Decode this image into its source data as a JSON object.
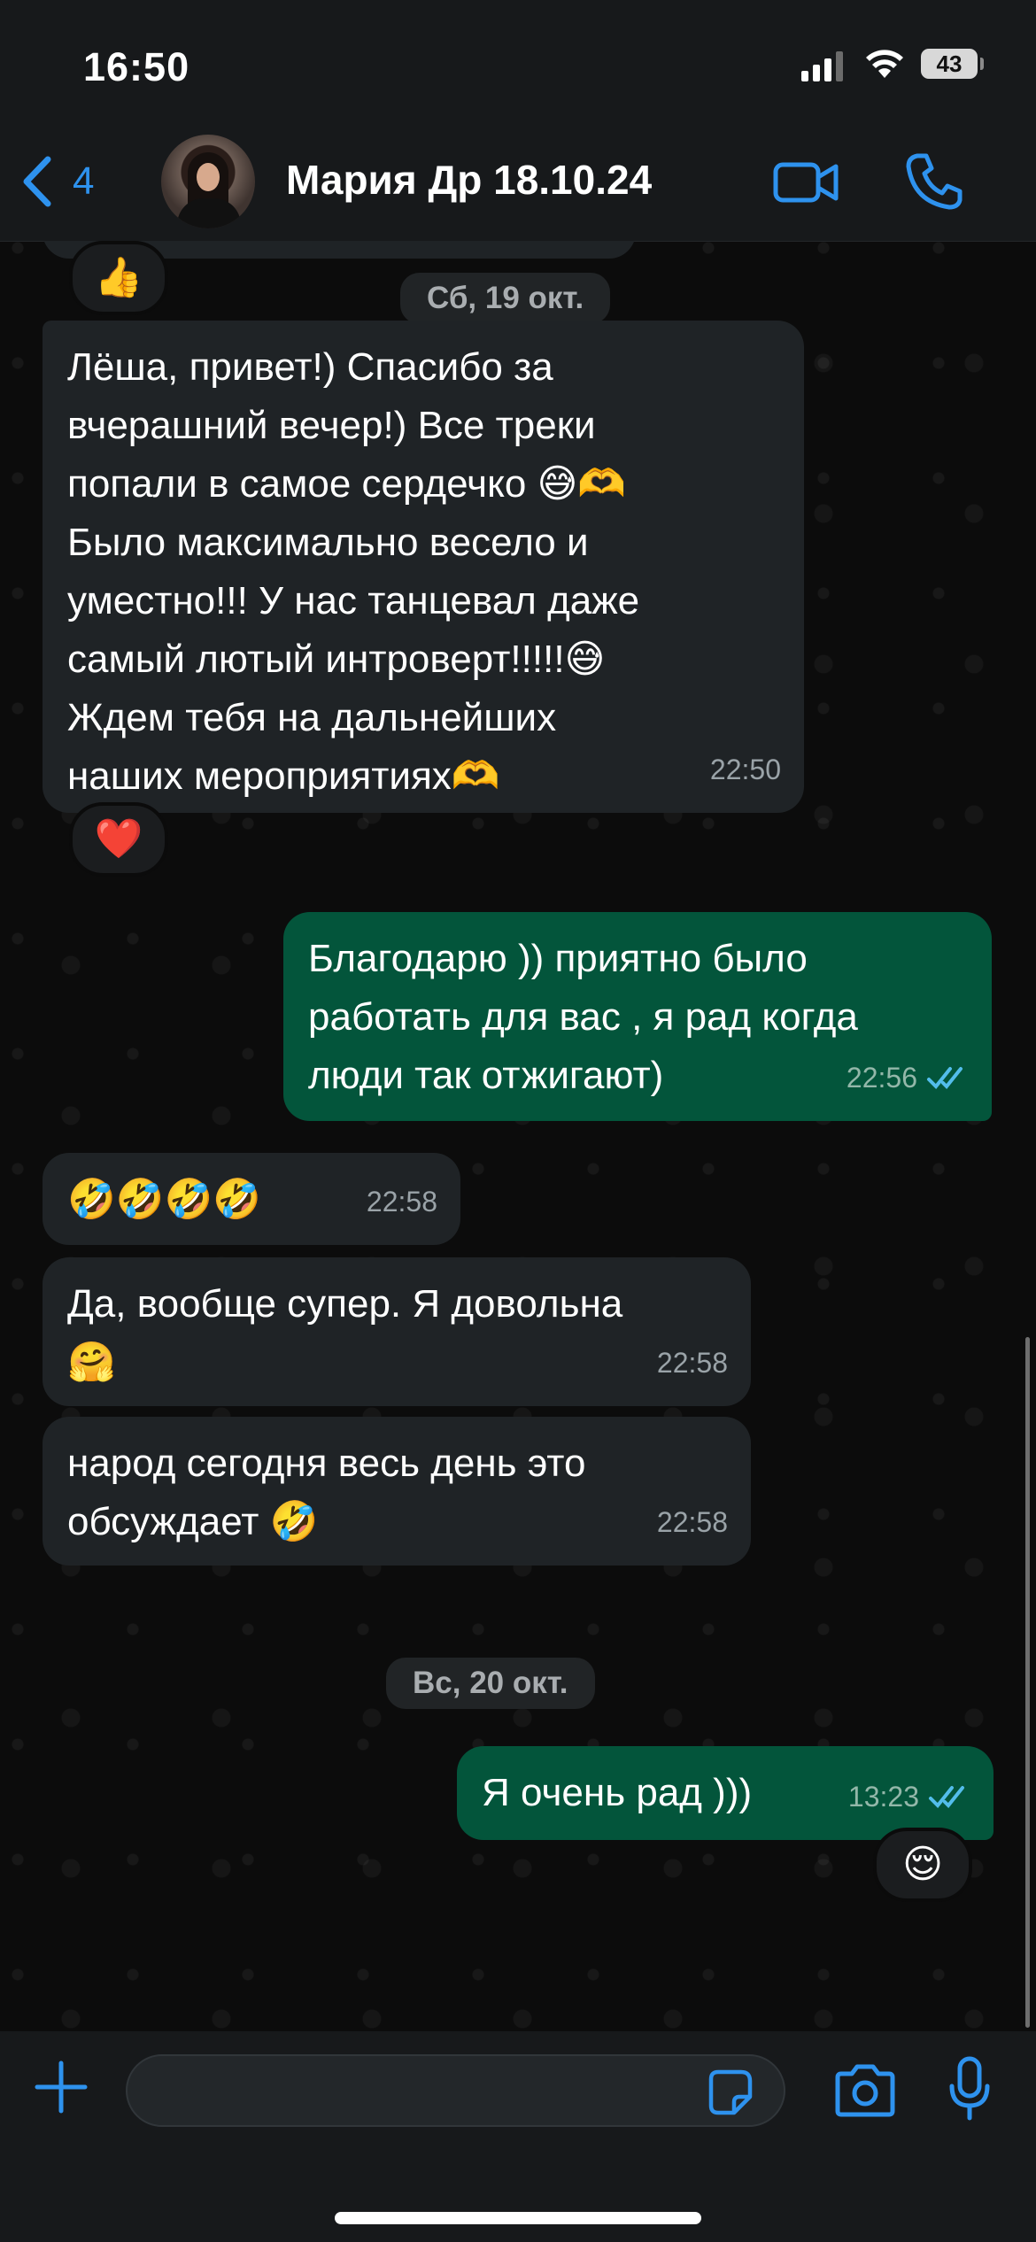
{
  "status_bar": {
    "time": "16:50",
    "battery": "43"
  },
  "header": {
    "back_count": "4",
    "contact_name": "Мария Др 18.10.24"
  },
  "chat": {
    "date_chip_1": "Сб, 19 окт.",
    "date_chip_2": "Вс, 20 окт.",
    "reaction_top": "👍",
    "msg1": {
      "lines": [
        "Лёша, привет!) Спасибо за",
        "вчерашний вечер!) Все треки",
        "попали в самое сердечко 😅🫶",
        "Было максимально весело и",
        "уместно!!! У нас танцевал даже",
        "самый лютый интроверт!!!!!😅",
        "Ждем тебя на дальнейших",
        "наших мероприятиях🫶"
      ],
      "time": "22:50",
      "reaction": "❤️"
    },
    "msg2": {
      "lines": [
        "Благодарю )) приятно было",
        "работать для вас , я рад когда",
        "люди так отжигают)"
      ],
      "time": "22:56"
    },
    "msg3": {
      "text": "🤣🤣🤣🤣",
      "time": "22:58"
    },
    "msg4": {
      "lines": [
        "Да, вообще супер. Я довольна",
        "🤗"
      ],
      "time": "22:58"
    },
    "msg5": {
      "lines": [
        "народ сегодня весь день это",
        "обсуждает 🤣"
      ],
      "time": "22:58"
    },
    "msg6": {
      "text": "Я очень рад )))",
      "time": "13:23",
      "reaction": "😌"
    }
  },
  "composer": {
    "input_value": ""
  },
  "icons": {
    "back": "chevron-left-icon",
    "video": "video-camera-icon",
    "phone": "phone-icon",
    "plus": "plus-icon",
    "sticker": "sticker-icon",
    "camera": "camera-icon",
    "mic": "microphone-icon",
    "read": "double-check-icon"
  },
  "colors": {
    "accent": "#2e92ee",
    "outgoing_bubble": "#03553b",
    "incoming_bubble": "#1f2326",
    "read_ticks": "#53bdeb"
  }
}
